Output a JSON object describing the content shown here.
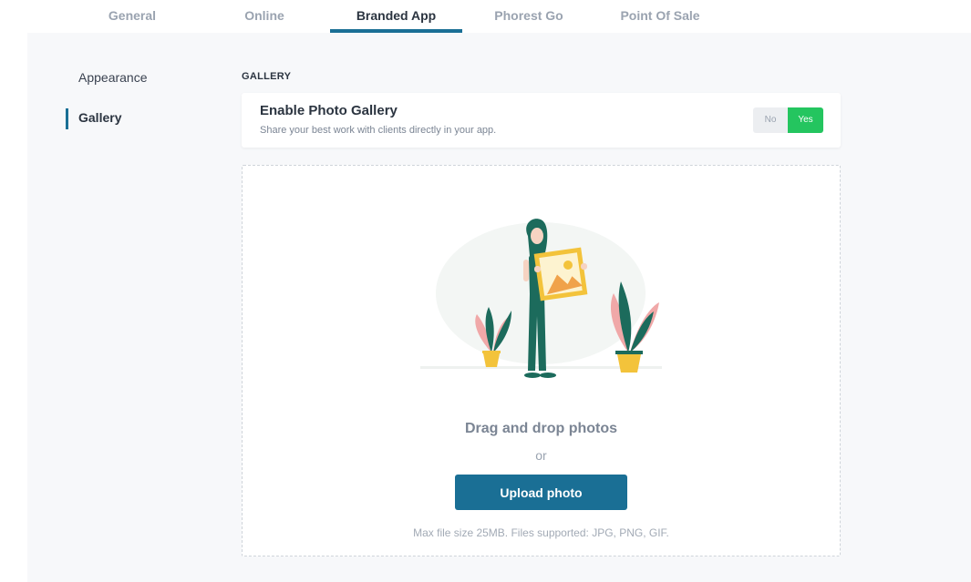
{
  "tabs": [
    {
      "label": "General"
    },
    {
      "label": "Online"
    },
    {
      "label": "Branded App"
    },
    {
      "label": "Phorest Go"
    },
    {
      "label": "Point Of Sale"
    }
  ],
  "sidebar": {
    "items": [
      {
        "label": "Appearance"
      },
      {
        "label": "Gallery"
      }
    ]
  },
  "gallery": {
    "section_title": "GALLERY",
    "card": {
      "title": "Enable Photo Gallery",
      "subtitle": "Share your best work with clients directly in your app.",
      "toggle_no": "No",
      "toggle_yes": "Yes"
    },
    "dropzone": {
      "drag_text": "Drag and drop photos",
      "or_text": "or",
      "upload_label": "Upload photo",
      "hint": "Max file size 25MB. Files supported: JPG, PNG, GIF."
    }
  },
  "colors": {
    "accent": "#1a6f95",
    "toggle_on": "#24c55f",
    "panel_bg": "#f7f8fa"
  }
}
